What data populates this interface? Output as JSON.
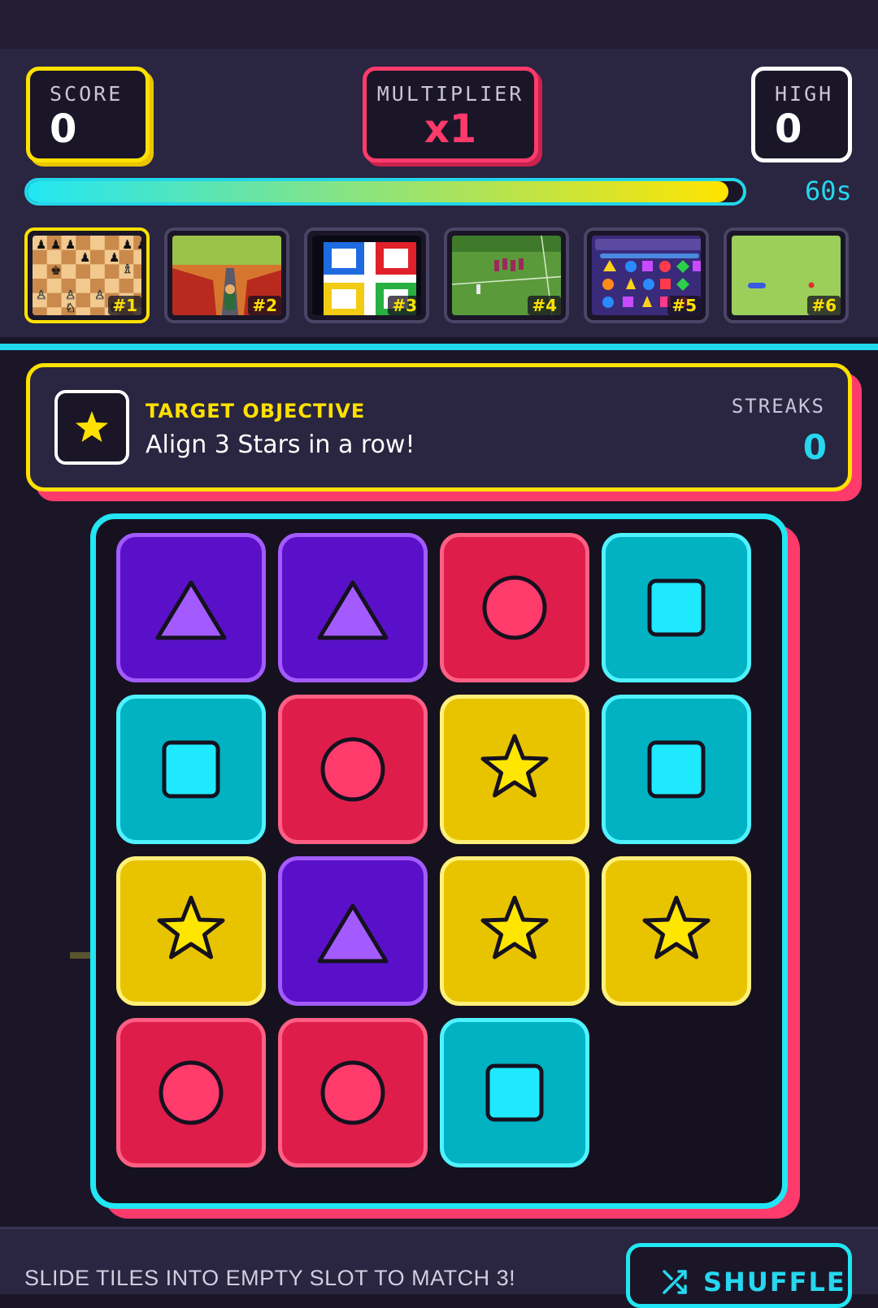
{
  "hud": {
    "score_label": "SCORE",
    "score_value": "0",
    "multiplier_label": "MULTIPLIER",
    "multiplier_value": "x1",
    "high_label": "HIGH",
    "high_value": "0"
  },
  "timer": {
    "remaining": "60s",
    "fill_fraction": 0.98
  },
  "game_thumbnails": [
    {
      "tag": "#1",
      "selected": true,
      "theme": "chess"
    },
    {
      "tag": "#2",
      "selected": false,
      "theme": "runner"
    },
    {
      "tag": "#3",
      "selected": false,
      "theme": "ludo"
    },
    {
      "tag": "#4",
      "selected": false,
      "theme": "soccer"
    },
    {
      "tag": "#5",
      "selected": false,
      "theme": "match-3"
    },
    {
      "tag": "#6",
      "selected": false,
      "theme": "snake"
    }
  ],
  "objective": {
    "title": "TARGET OBJECTIVE",
    "text": "Align 3 Stars in a row!",
    "icon": "star-icon",
    "streaks_label": "STREAKS",
    "streaks_value": "0"
  },
  "board": {
    "rows": [
      [
        "triangle",
        "triangle",
        "circle",
        "square"
      ],
      [
        "square",
        "circle",
        "star",
        "square"
      ],
      [
        "star",
        "triangle",
        "star",
        "star"
      ],
      [
        "circle",
        "circle",
        "square",
        "empty"
      ]
    ]
  },
  "footer": {
    "hint": "SLIDE TILES INTO EMPTY SLOT TO MATCH 3!",
    "shuffle_label": "SHUFFLE",
    "shuffle_icon": "shuffle-icon"
  },
  "colors": {
    "yellow": "#ffe100",
    "pink": "#ff3b6b",
    "cyan": "#22e6f3",
    "purple": "#5a10c8"
  }
}
